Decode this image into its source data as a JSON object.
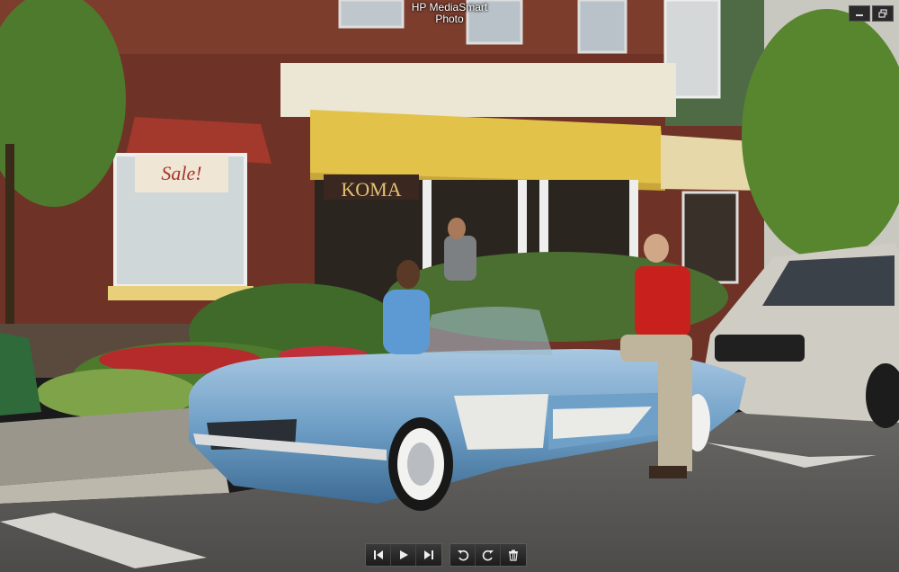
{
  "app": {
    "title_line1": "HP MediaSmart",
    "title_line2": "Photo"
  },
  "window_controls": [
    {
      "icon": "minimize-icon"
    },
    {
      "icon": "restore-icon"
    }
  ],
  "photo": {
    "storefront_sign": "KOMA",
    "sale_sign": "Sale!"
  },
  "toolbar": {
    "playback": [
      {
        "icon": "previous-icon"
      },
      {
        "icon": "play-icon"
      },
      {
        "icon": "next-icon"
      }
    ],
    "edit": [
      {
        "icon": "rotate-left-icon"
      },
      {
        "icon": "rotate-right-icon"
      },
      {
        "icon": "delete-icon"
      }
    ]
  },
  "colors": {
    "brick": "#7a3a2c",
    "awning_yellow": "#e3c24a",
    "car_blue": "#6f9fc6",
    "asphalt": "#5a5a58",
    "toolbar_bg": "#2a2a2a"
  }
}
